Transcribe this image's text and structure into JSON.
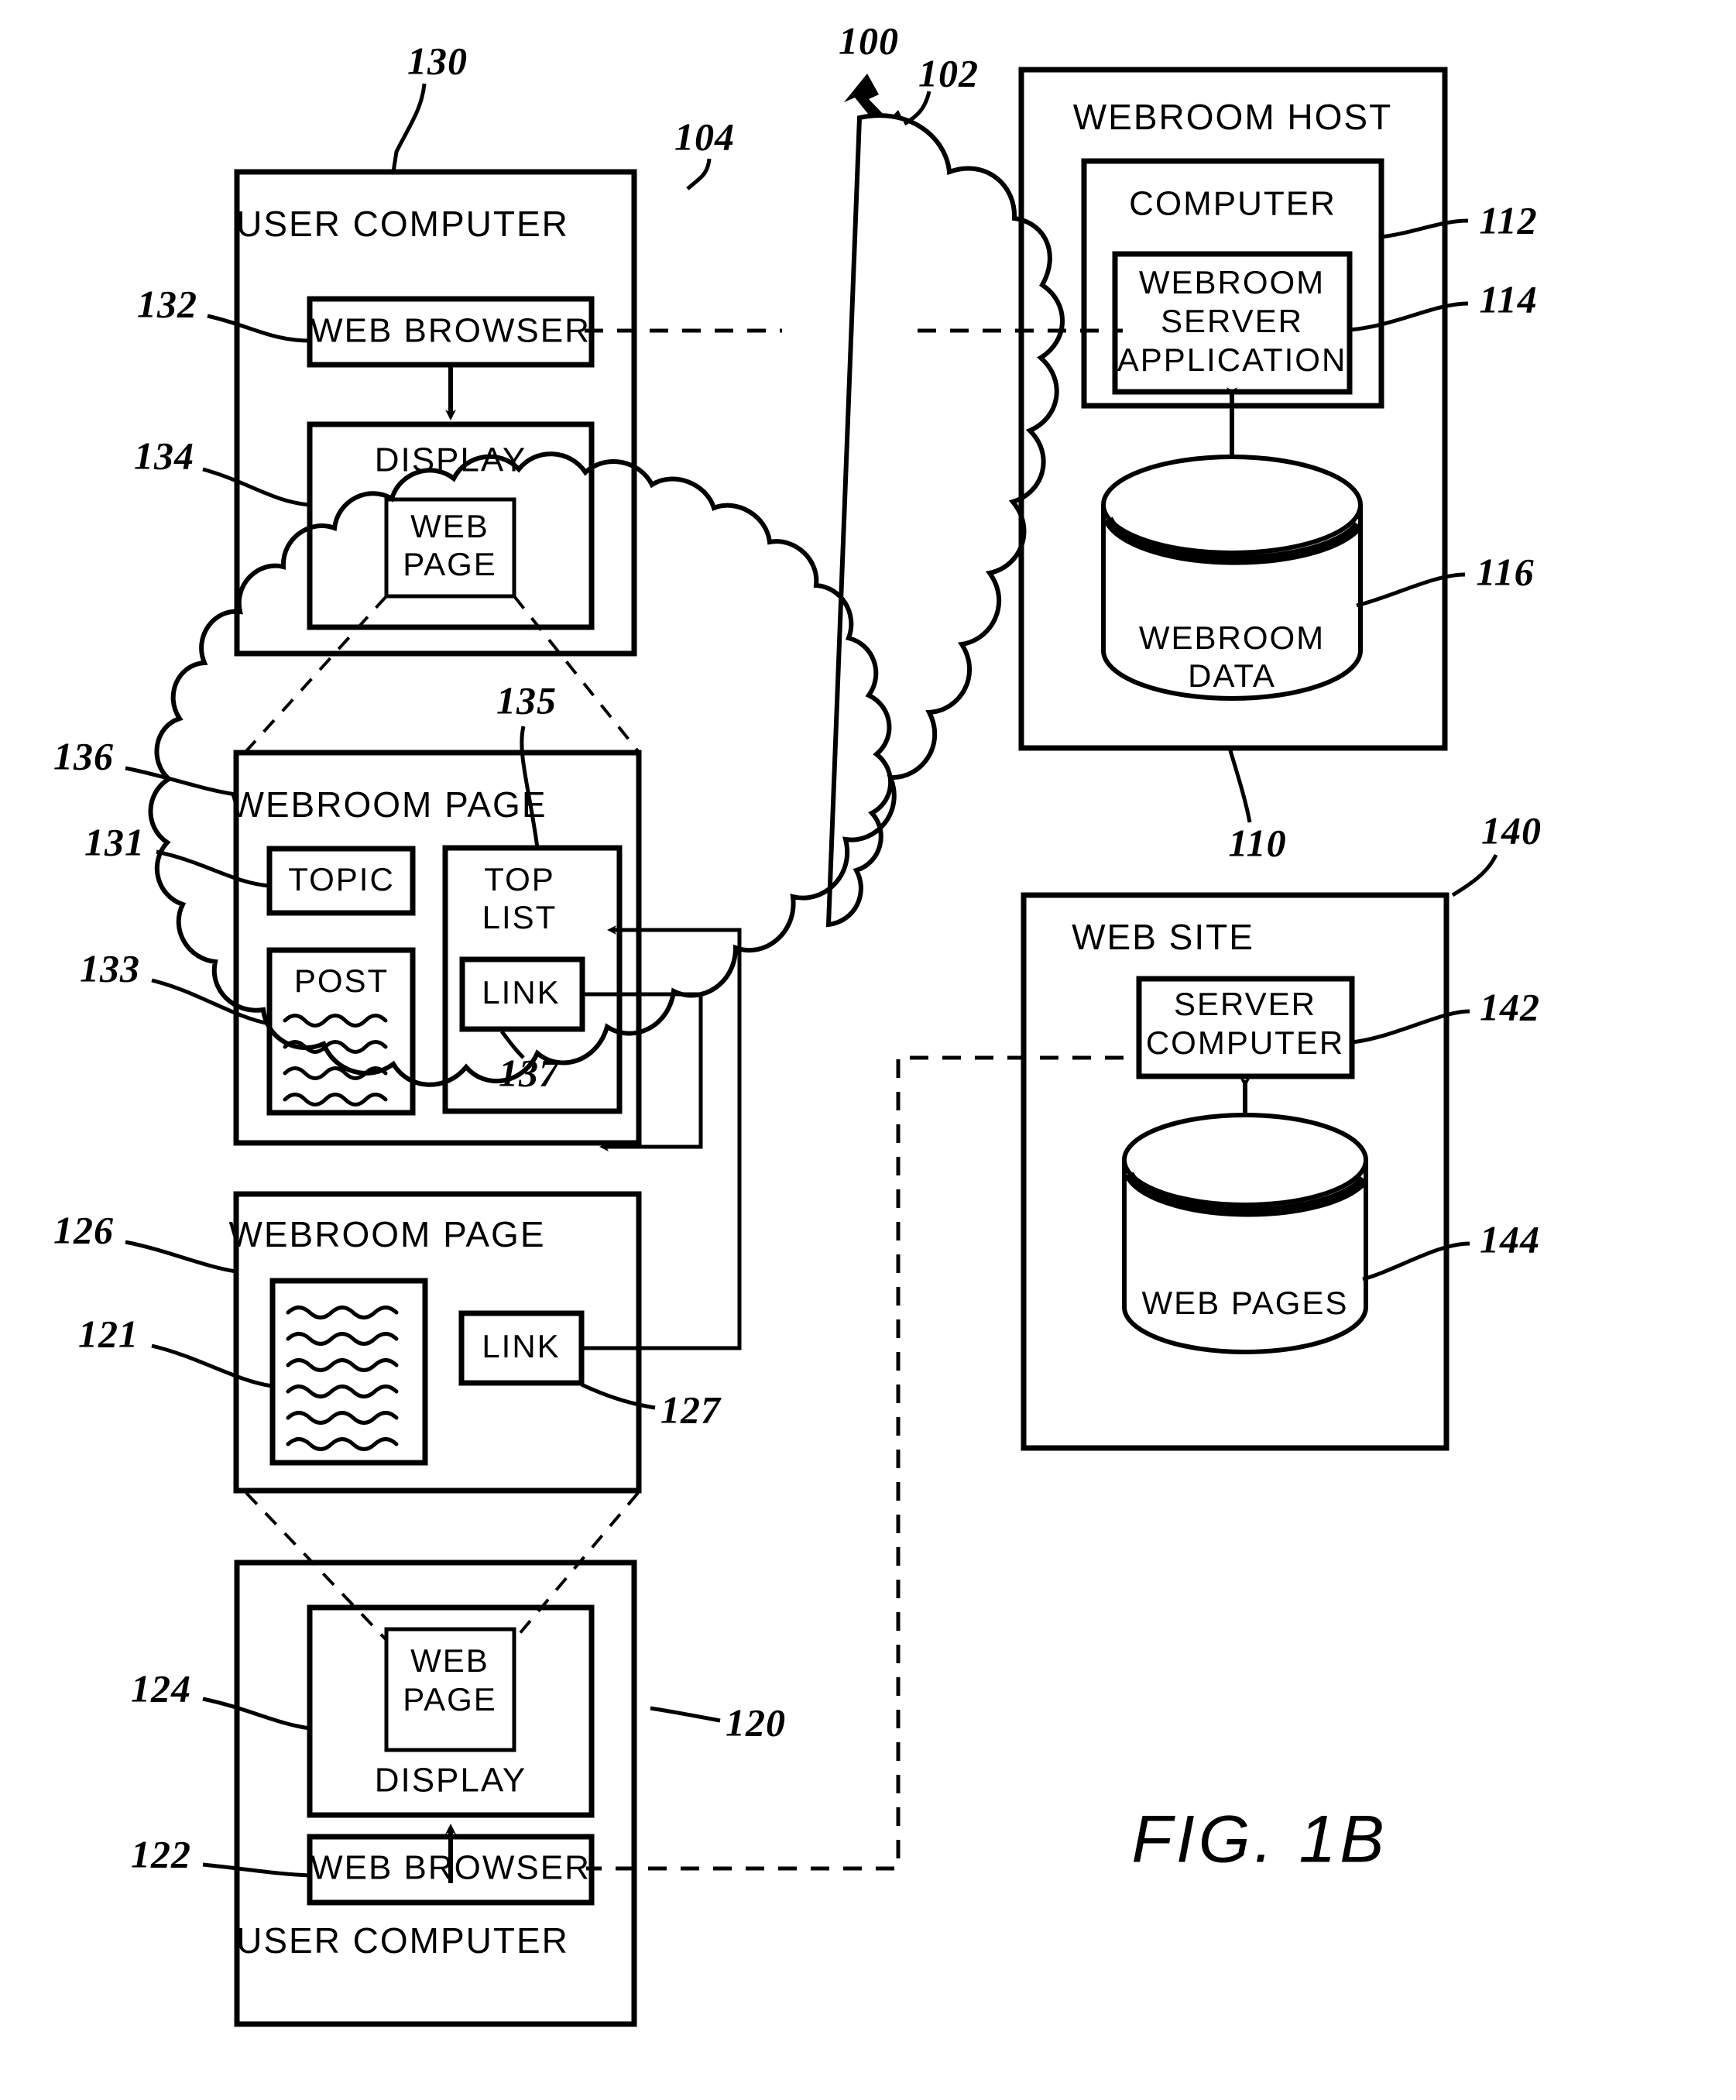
{
  "figure": {
    "caption": "FIG.  1B",
    "system_ref": "100"
  },
  "network": {
    "cloud_ref": "102",
    "connection_ref": "104"
  },
  "user_computer_top": {
    "ref": "130",
    "title": "USER COMPUTER",
    "web_browser": {
      "label": "WEB BROWSER",
      "ref": "132"
    },
    "display": {
      "label": "DISPLAY",
      "ref": "134"
    },
    "web_page": {
      "label_line1": "WEB",
      "label_line2": "PAGE"
    }
  },
  "webroom_host": {
    "ref": "110",
    "title": "WEBROOM HOST",
    "computer": {
      "label": "COMPUTER",
      "ref": "112"
    },
    "server_application": {
      "label_line1": "WEBROOM",
      "label_line2": "SERVER",
      "label_line3": "APPLICATION",
      "ref": "114"
    },
    "webroom_data": {
      "label_line1": "WEBROOM",
      "label_line2": "DATA",
      "ref": "116"
    }
  },
  "web_site": {
    "ref": "140",
    "title": "WEB SITE",
    "server_computer": {
      "label_line1": "SERVER",
      "label_line2": "COMPUTER",
      "ref": "142"
    },
    "web_pages": {
      "label": "WEB PAGES",
      "ref": "144"
    }
  },
  "webroom_page_upper": {
    "ref": "136",
    "title": "WEBROOM PAGE",
    "topic": {
      "label": "TOPIC",
      "ref": "131"
    },
    "post": {
      "label": "POST",
      "ref": "133"
    },
    "top_list": {
      "label_line1": "TOP",
      "label_line2": "LIST",
      "ref": "135"
    },
    "link": {
      "label": "LINK",
      "ref": "137"
    }
  },
  "webroom_page_lower": {
    "ref": "126",
    "title": "WEBROOM PAGE",
    "post": {
      "ref": "121"
    },
    "link": {
      "label": "LINK",
      "ref": "127"
    }
  },
  "user_computer_bottom": {
    "ref": "120",
    "title": "USER COMPUTER",
    "web_browser": {
      "label": "WEB BROWSER",
      "ref": "122"
    },
    "display": {
      "label": "DISPLAY",
      "ref": "124"
    },
    "web_page": {
      "label_line1": "WEB",
      "label_line2": "PAGE"
    }
  },
  "colors": {
    "ink": "#000000",
    "paper": "#ffffff"
  }
}
